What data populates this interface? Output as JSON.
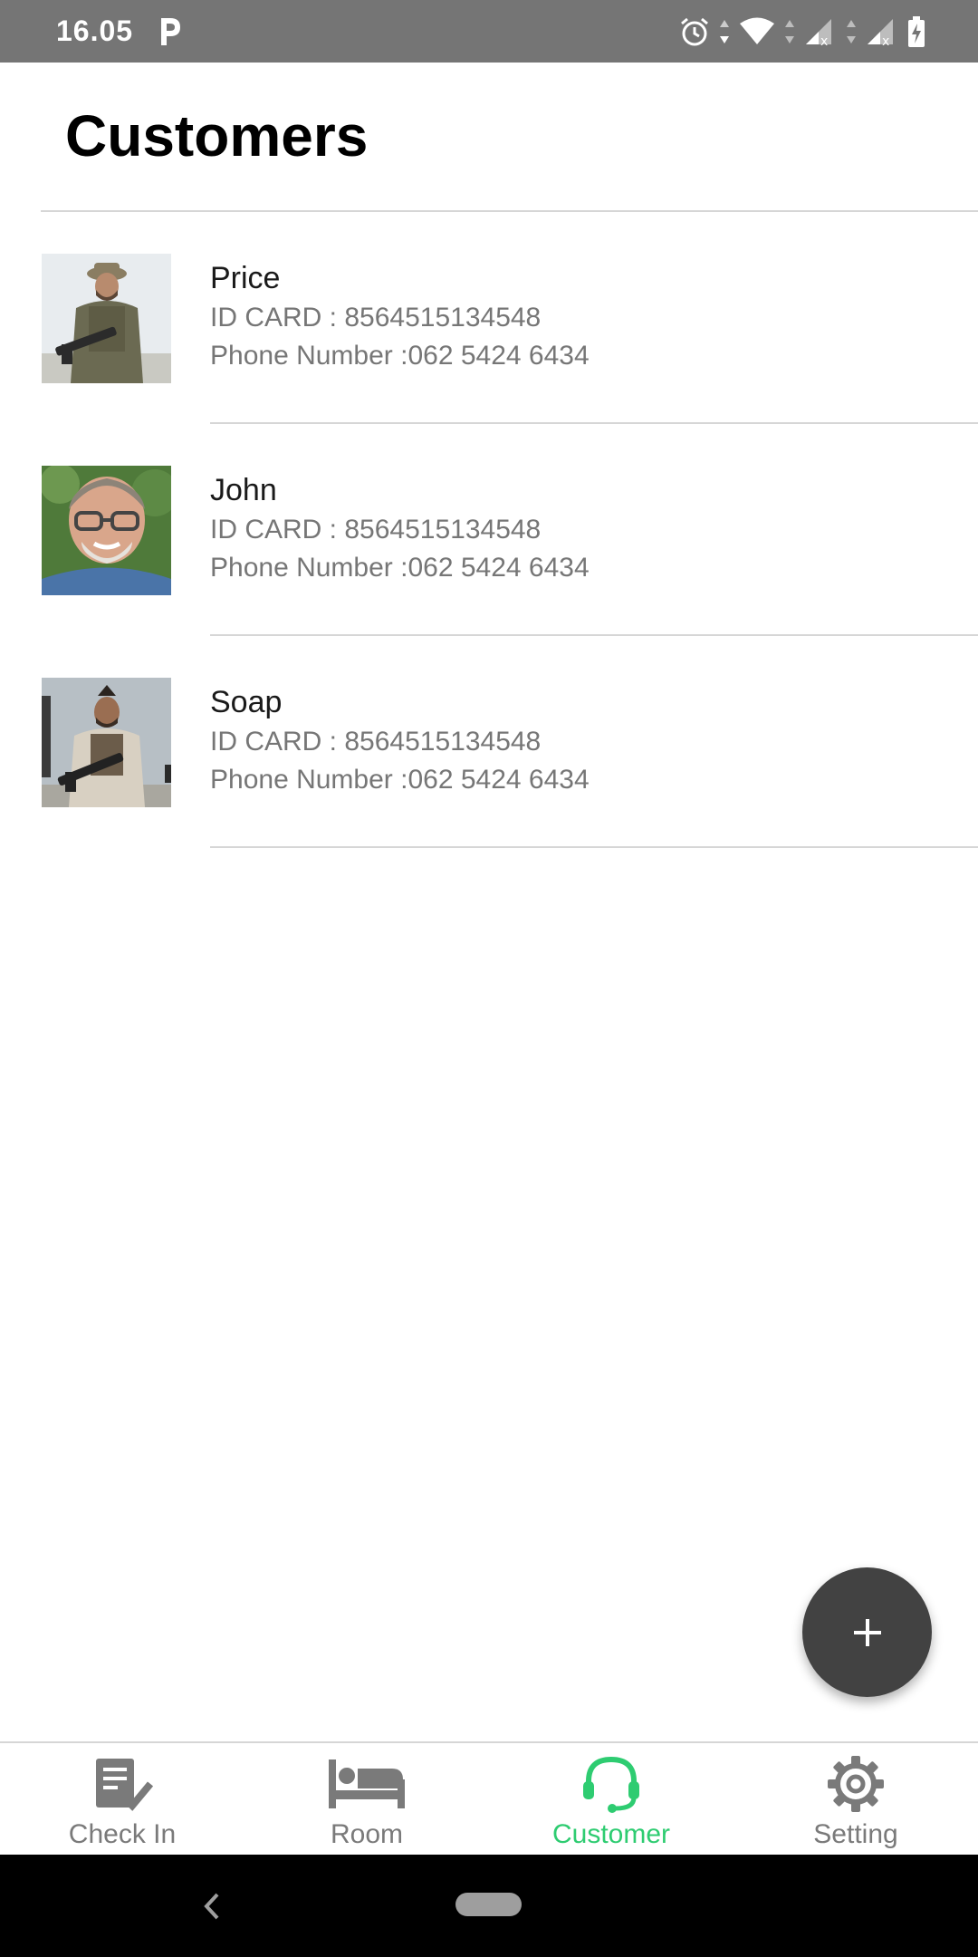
{
  "status_bar": {
    "time": "16.05"
  },
  "header": {
    "title": "Customers"
  },
  "customers": [
    {
      "name": "Price",
      "id_card": "ID CARD : 8564515134548",
      "phone": "Phone Number :062 5424 6434"
    },
    {
      "name": "John",
      "id_card": "ID CARD : 8564515134548",
      "phone": "Phone Number :062 5424 6434"
    },
    {
      "name": "Soap",
      "id_card": "ID CARD : 8564515134548",
      "phone": "Phone Number :062 5424 6434"
    }
  ],
  "fab": {
    "icon": "plus-icon"
  },
  "bottom_nav": {
    "items": [
      {
        "label": "Check In",
        "icon": "checklist-icon"
      },
      {
        "label": "Room",
        "icon": "bed-icon"
      },
      {
        "label": "Customer",
        "icon": "headset-icon"
      },
      {
        "label": "Setting",
        "icon": "gear-icon"
      }
    ],
    "active_index": 2
  },
  "colors": {
    "accent": "#2ecc71",
    "status_bar": "#757575",
    "fab": "#424242",
    "nav_inactive": "#7a7a7a"
  }
}
